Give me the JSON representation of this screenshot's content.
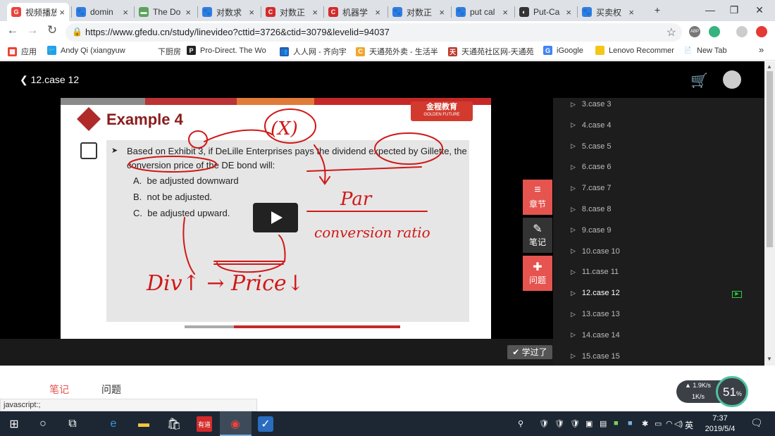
{
  "browser": {
    "tabs": [
      {
        "title": "视频播放",
        "color": "#e8443a",
        "glyph": "G"
      },
      {
        "title": "domin",
        "color": "#2f7de1",
        "glyph": "🐾"
      },
      {
        "title": "The Do",
        "color": "#5aa35a",
        "glyph": "▬"
      },
      {
        "title": "对数求",
        "color": "#2f7de1",
        "glyph": "🐾"
      },
      {
        "title": "对数正",
        "color": "#d42a2a",
        "glyph": "C"
      },
      {
        "title": "机器学",
        "color": "#d42a2a",
        "glyph": "C"
      },
      {
        "title": "对数正",
        "color": "#2f7de1",
        "glyph": "🐾"
      },
      {
        "title": "put cal",
        "color": "#2f7de1",
        "glyph": "🐾"
      },
      {
        "title": "Put-Ca",
        "color": "#333333",
        "glyph": "◐"
      },
      {
        "title": "买卖权",
        "color": "#2f7de1",
        "glyph": "🐾"
      }
    ],
    "tab_close": "×",
    "new_tab": "+",
    "win_min": "—",
    "win_restore": "❐",
    "win_close": "✕",
    "url": "https://www.gfedu.cn/study/linevideo?cttid=3726&ctid=3079&levelid=94037",
    "bookmarks": [
      {
        "label": "应用",
        "color": "#e94235",
        "glyph": "▦"
      },
      {
        "label": "Andy Qi (xiangyuw",
        "color": "#1da1f2",
        "glyph": "🐦"
      },
      {
        "label": "下厨房",
        "color": "#ffffff",
        "glyph": ""
      },
      {
        "label": "Pro-Direct. The Wo",
        "color": "#222222",
        "glyph": "P"
      },
      {
        "label": "人人网 - 齐向宇",
        "color": "#2a5db0",
        "glyph": "👥"
      },
      {
        "label": "天通苑外卖 - 生活半",
        "color": "#f0a830",
        "glyph": "C"
      },
      {
        "label": "天通苑社区网-天通苑",
        "color": "#c0392b",
        "glyph": "天"
      },
      {
        "label": "iGoogle",
        "color": "#4285f4",
        "glyph": "G"
      },
      {
        "label": "Lenovo Recommen",
        "color": "#f5c518",
        "glyph": ""
      },
      {
        "label": "New Tab",
        "color": "#ffffff",
        "glyph": "📄"
      }
    ],
    "bookmarks_more": "»"
  },
  "header": {
    "back_label": "12.case 12"
  },
  "slide": {
    "title": "Example 4",
    "logo_text": "金程教育",
    "logo_sub": "GOLDEN FUTURE",
    "question": "Based on Exhibit 3, if DeLille Enterprises pays the dividend expected by Gillette, the conversion price of the DE bond will:",
    "options": [
      {
        "letter": "A.",
        "text": "be adjusted downward"
      },
      {
        "letter": "B.",
        "text": "not be adjusted."
      },
      {
        "letter": "C.",
        "text": "be adjusted upward."
      }
    ],
    "handwriting": {
      "x_mark": "(X)",
      "par": "Par",
      "ratio": "conversion ratio",
      "note": "Div↑ → Price↓"
    }
  },
  "video": {
    "learned_label": "✔ 学过了"
  },
  "side_buttons": [
    {
      "label": "章节",
      "icon": "≡",
      "color": "#e5544f"
    },
    {
      "label": "笔记",
      "icon": "✎",
      "color": "#333333"
    },
    {
      "label": "问题",
      "icon": "✚",
      "color": "#e5544f"
    }
  ],
  "chapters": [
    {
      "label": "3.case 3",
      "active": false
    },
    {
      "label": "4.case 4",
      "active": false
    },
    {
      "label": "5.case 5",
      "active": false
    },
    {
      "label": "6.case 6",
      "active": false
    },
    {
      "label": "7.case 7",
      "active": false
    },
    {
      "label": "8.case 8",
      "active": false
    },
    {
      "label": "9.case 9",
      "active": false
    },
    {
      "label": "10.case 10",
      "active": false
    },
    {
      "label": "11.case 11",
      "active": false
    },
    {
      "label": "12.case 12",
      "active": true
    },
    {
      "label": "13.case 13",
      "active": false
    },
    {
      "label": "14.case 14",
      "active": false
    },
    {
      "label": "15.case 15",
      "active": false
    }
  ],
  "bottom_tabs": [
    {
      "label": "笔记",
      "active": true
    },
    {
      "label": "问题",
      "active": false
    }
  ],
  "status_text": "javascript:;",
  "speed_widget": {
    "up": "1.9K/s",
    "down": "1K/s",
    "percent": "51",
    "percent_unit": "%"
  },
  "taskbar": {
    "time": "7:37",
    "date": "2019/5/4",
    "ime": "英"
  },
  "colors": {
    "accent_red": "#e5544f",
    "brand_red": "#d23a2e"
  }
}
